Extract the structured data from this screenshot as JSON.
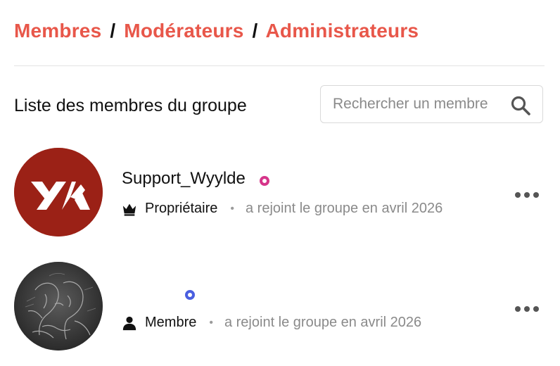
{
  "tabs": {
    "members": "Membres",
    "moderators": "Modérateurs",
    "administrators": "Administrateurs",
    "separator": "/"
  },
  "list": {
    "title": "Liste des membres du groupe"
  },
  "search": {
    "placeholder": "Rechercher un membre",
    "value": "",
    "icon": "search-icon"
  },
  "members": [
    {
      "name": "Support_Wyylde",
      "avatar": "brand-logo-avatar",
      "avatar_color": "#9b2116",
      "status_color": "#d6358a",
      "role_icon": "crown-icon",
      "role": "Propriétaire",
      "separator": "•",
      "joined": "a rejoint le groupe en avril 2026"
    },
    {
      "name": "",
      "avatar": "sketch-photo-avatar",
      "avatar_color": "#3c3c3c",
      "status_color": "#4a5fe0",
      "role_icon": "person-icon",
      "role": "Membre",
      "separator": "•",
      "joined": "a rejoint le groupe en avril 2026"
    }
  ],
  "colors": {
    "accent": "#e8574a",
    "text": "#111111",
    "muted": "#8a8a8a",
    "divider": "#e3e3e3"
  }
}
